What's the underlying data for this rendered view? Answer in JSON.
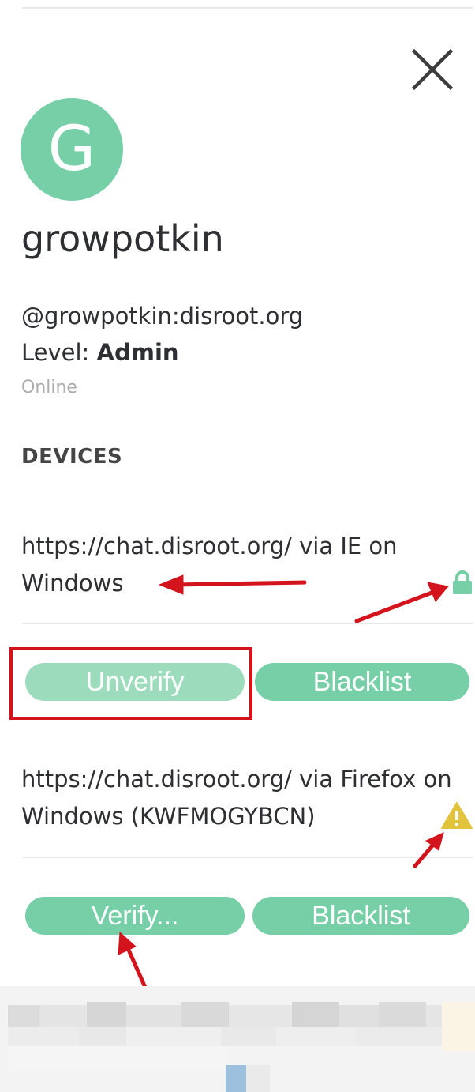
{
  "profile": {
    "avatar_letter": "G",
    "display_name": "growpotkin",
    "user_id": "@growpotkin:disroot.org",
    "level_label": "Level: ",
    "level_value": "Admin",
    "presence": "Online"
  },
  "devices": {
    "heading": "DEVICES",
    "items": [
      {
        "name": "https://chat.disroot.org/ via IE on Windows",
        "status_icon": "lock-icon",
        "primary_button": "Unverify",
        "secondary_button": "Blacklist"
      },
      {
        "name": "https://chat.disroot.org/ via Firefox on Windows (KWFMOGYBCN)",
        "status_icon": "warning-icon",
        "primary_button": "Verify...",
        "secondary_button": "Blacklist"
      }
    ]
  },
  "icons": {
    "close": "close-icon",
    "lock": "lock-icon",
    "warning": "warning-icon"
  },
  "colors": {
    "accent": "#76cfa6",
    "accent_light": "#9cdcbd",
    "warning": "#e2c33c",
    "annotation": "#d4141c",
    "muted_text": "#acacac"
  }
}
